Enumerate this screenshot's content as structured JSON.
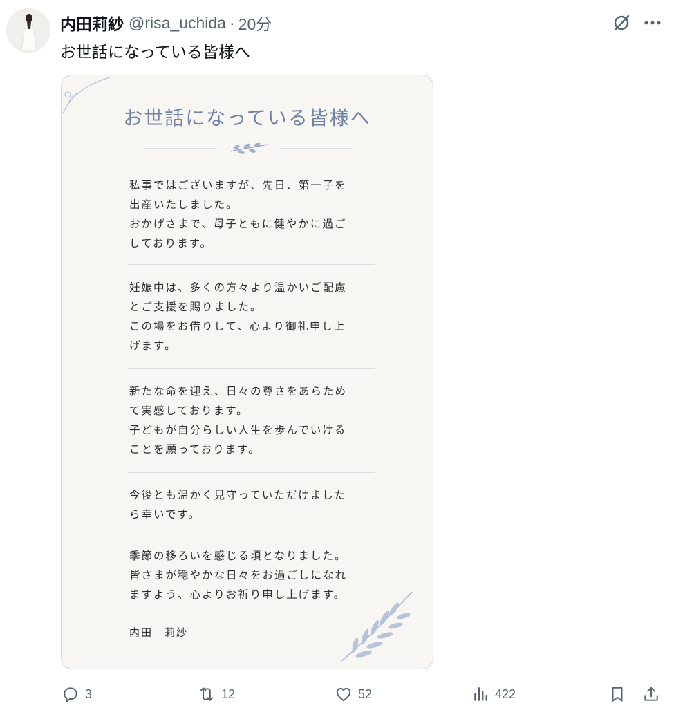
{
  "post": {
    "display_name": "内田莉紗",
    "handle": "@risa_uchida",
    "separator": "·",
    "time": "20分",
    "text": "お世話になっている皆様へ"
  },
  "card": {
    "title": "お世話になっている皆様へ",
    "paragraphs": [
      [
        "私事ではございますが、先日、第一子を",
        "出産いたしました。",
        "おかげさまで、母子ともに健やかに過ご",
        "しております。"
      ],
      [
        "妊娠中は、多くの方々より温かいご配慮",
        "とご支援を賜りました。",
        "この場をお借りして、心より御礼申し上",
        "げます。"
      ],
      [
        "新たな命を迎え、日々の尊さをあらため",
        "て実感しております。",
        "子どもが自分らしい人生を歩んでいける",
        "ことを願っております。"
      ],
      [
        "今後とも温かく見守っていただけました",
        "ら幸いです。"
      ],
      [
        "季節の移ろいを感じる頃となりました。",
        "皆さまが穏やかな日々をお過ごしになれ",
        "ますよう、心よりお祈り申し上げます。"
      ]
    ],
    "signature": "内田　莉紗"
  },
  "actions": {
    "replies": "3",
    "reposts": "12",
    "likes": "52",
    "views": "422"
  },
  "icons": [
    "grok-icon",
    "more-icon",
    "reply-icon",
    "repost-icon",
    "like-icon",
    "views-icon",
    "bookmark-icon",
    "share-icon"
  ],
  "colors": {
    "text": "#0f1419",
    "secondary": "#536471",
    "card_title": "#6f83a6",
    "card_bg": "#f7f6f3"
  }
}
